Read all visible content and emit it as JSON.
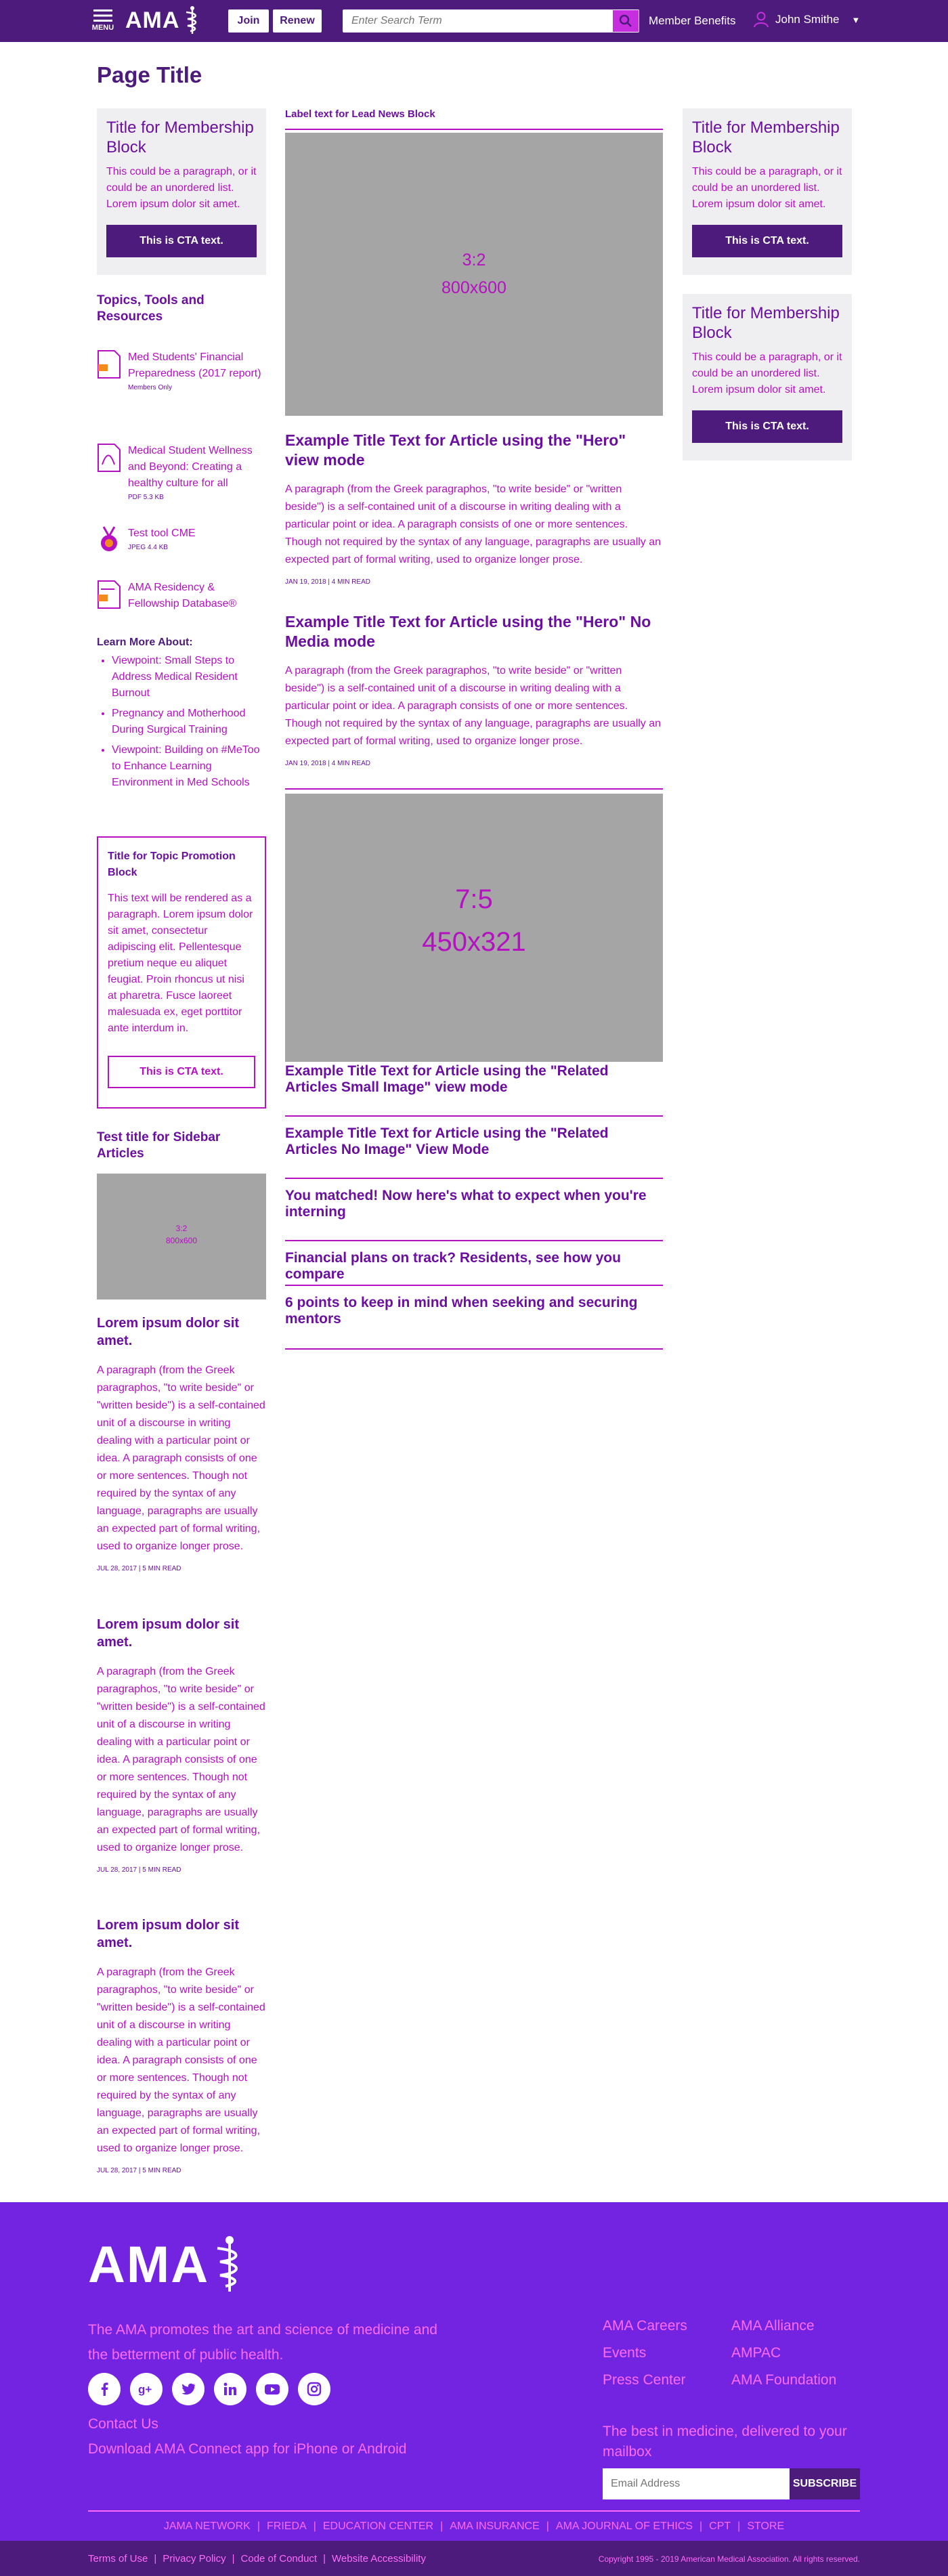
{
  "header": {
    "menu_label": "MENU",
    "logo_text": "AMA",
    "join_label": "Join",
    "renew_label": "Renew",
    "search_placeholder": "Enter Search Term",
    "member_benefits": "Member Benefits",
    "user_name": "John Smithe",
    "colors": {
      "bar": "#4d1b7b",
      "accent": "#c62ee0"
    }
  },
  "page_title": "Page Title",
  "left": {
    "membership": {
      "title": "Title for Membership Block",
      "text": "This could be a paragraph, or it could be an unordered list. Lorem ipsum dolor sit amet.",
      "cta": "This is CTA text."
    },
    "topics_heading": "Topics, Tools and Resources",
    "resources": [
      {
        "title": "Med Students' Financial Preparedness (2017 report)",
        "meta": "Members Only",
        "icon": "document-icon"
      },
      {
        "title": "Medical Student Wellness and Beyond: Creating a healthy culture for all",
        "meta": "PDF        5.3 KB",
        "icon": "pdf-icon"
      },
      {
        "title": "Test tool CME",
        "meta": "JPEG        4.4 KB",
        "icon": "medal-icon"
      },
      {
        "title": "AMA Residency & Fellowship Database®",
        "meta": "",
        "icon": "database-icon"
      }
    ],
    "learn_more": {
      "heading": "Learn More About:",
      "items": [
        "Viewpoint: Small Steps to Address Medical Resident Burnout",
        "Pregnancy and Motherhood During Surgical Training",
        "Viewpoint: Building on #MeToo to Enhance Learning Environment in Med Schools"
      ]
    },
    "promo": {
      "title": "Title for Topic Promotion Block",
      "text": "This text will be rendered as a paragraph. Lorem ipsum dolor sit amet, consectetur adipiscing elit. Pellentesque pretium neque eu aliquet feugiat. Proin rhoncus ut nisi at pharetra. Fusce laoreet malesuada ex, eget porttitor ante interdum in.",
      "cta": "This is CTA text."
    },
    "sidebar_articles_heading": "Test title for Sidebar Articles",
    "sidebar_image": {
      "ratio": "3:2",
      "size": "800x600"
    },
    "sidebar_articles": [
      {
        "title": "Lorem ipsum dolor sit amet.",
        "text": "A paragraph (from the Greek paragraphos, \"to write beside\" or \"written beside\") is a self-contained unit of a discourse in writing dealing with a particular point or idea. A paragraph consists of one or more sentences. Though not required by the syntax of any language, paragraphs are usually an expected part of formal writing, used to organize longer prose.",
        "meta": "JUL 28, 2017  |  5 MIN READ"
      },
      {
        "title": "Lorem ipsum dolor sit amet.",
        "text": "A paragraph (from the Greek paragraphos, \"to write beside\" or \"written beside\") is a self-contained unit of a discourse in writing dealing with a particular point or idea. A paragraph consists of one or more sentences. Though not required by the syntax of any language, paragraphs are usually an expected part of formal writing, used to organize longer prose.",
        "meta": "JUL 28, 2017  |  5 MIN READ"
      },
      {
        "title": "Lorem ipsum dolor sit amet.",
        "text": "A paragraph (from the Greek paragraphos, \"to write beside\" or \"written beside\") is a self-contained unit of a discourse in writing dealing with a particular point or idea. A paragraph consists of one or more sentences. Though not required by the syntax of any language, paragraphs are usually an expected part of formal writing, used to organize longer prose.",
        "meta": "JUL 28, 2017  |  5 MIN READ"
      }
    ]
  },
  "center": {
    "label": "Label text for Lead News Block",
    "hero_image": {
      "ratio": "3:2",
      "size": "800x600"
    },
    "articles": [
      {
        "title": "Example Title Text for Article using the \"Hero\" view mode",
        "text": "A paragraph (from the Greek paragraphos, \"to write beside\" or \"written beside\") is a self-contained unit of a discourse in writing dealing with a particular point or idea. A paragraph consists of one or more sentences. Though not required by the syntax of any language, paragraphs are usually an expected part of formal writing, used to organize longer prose.",
        "meta": "JAN 19, 2018  |  4 MIN READ"
      },
      {
        "title": "Example Title Text for Article using the \"Hero\" No Media mode",
        "text": "A paragraph (from the Greek paragraphos, \"to write beside\" or \"written beside\") is a self-contained unit of a discourse in writing dealing with a particular point or idea. A paragraph consists of one or more sentences. Though not required by the syntax of any language, paragraphs are usually an expected part of formal writing, used to organize longer prose.",
        "meta": "JAN 19, 2018  |  4 MIN READ"
      }
    ],
    "related_image": {
      "ratio": "7:5",
      "size": "450x321"
    },
    "related": [
      "Example Title Text for Article using the \"Related Articles Small Image\" view mode",
      "Example Title Text for Article using the \"Related Articles No Image\" View Mode",
      "You matched! Now here's what to expect when you're interning",
      "Financial plans on track? Residents, see how you compare",
      "6 points to keep in mind when seeking and securing mentors"
    ]
  },
  "right": {
    "blocks": [
      {
        "title": "Title for Membership Block",
        "text": "This could be a paragraph, or it could be an unordered list. Lorem ipsum dolor sit amet.",
        "cta": "This is CTA text."
      },
      {
        "title": "Title for Membership Block",
        "text": "This could be a paragraph, or it could be an unordered list. Lorem ipsum dolor sit amet.",
        "cta": "This is CTA text."
      }
    ]
  },
  "footer": {
    "logo_text": "AMA",
    "promise": "The AMA promotes the art and science of medicine and the betterment of public health.",
    "social": [
      "facebook-icon",
      "google-plus-icon",
      "twitter-icon",
      "linkedin-icon",
      "youtube-icon",
      "instagram-icon"
    ],
    "contact": "Contact Us",
    "download": "Download AMA Connect app for iPhone or Android",
    "links": [
      "AMA Careers",
      "AMA Alliance",
      "Events",
      "AMPAC",
      "Press Center",
      "AMA Foundation"
    ],
    "newsletter": "The best in medicine, delivered to your mailbox",
    "email_placeholder": "Email Address",
    "subscribe": "SUBSCRIBE",
    "networks": [
      "JAMA NETWORK",
      "FRIEDA",
      "EDUCATION CENTER",
      "AMA INSURANCE",
      "AMA JOURNAL OF ETHICS",
      "CPT",
      "STORE"
    ],
    "legal": [
      "Terms of Use",
      "Privacy Policy",
      "Code of Conduct",
      "Website Accessibility"
    ],
    "copyright": "Copyright 1995 - 2019 American Medical Association. All rights reserved.",
    "colors": {
      "bg": "#7324e0",
      "text": "#ff6bff",
      "legal_bg": "#4d1b7b"
    }
  }
}
